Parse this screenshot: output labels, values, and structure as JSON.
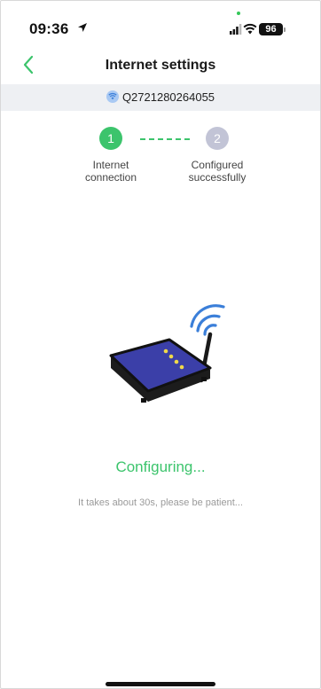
{
  "status_bar": {
    "time": "09:36",
    "battery": "96",
    "icons": [
      "location-arrow-icon",
      "signal-icon",
      "wifi-icon",
      "battery-icon"
    ]
  },
  "nav": {
    "back_icon": "chevron-left-icon",
    "title": "Internet settings"
  },
  "device": {
    "icon": "wifi-icon",
    "id": "Q2721280264055"
  },
  "steps": [
    {
      "number": "1",
      "label_line1": "Internet",
      "label_line2": "connection",
      "state": "active"
    },
    {
      "number": "2",
      "label_line1": "Configured",
      "label_line2": "successfully",
      "state": "pending"
    }
  ],
  "status": {
    "title": "Configuring...",
    "hint": "It takes about 30s, please be patient..."
  },
  "colors": {
    "accent": "#3cc46c",
    "pending": "#c2c4d6",
    "device_top": "#3b3fa8",
    "led": "#f0d94a",
    "wifi_waves": "#3b7fd9"
  }
}
